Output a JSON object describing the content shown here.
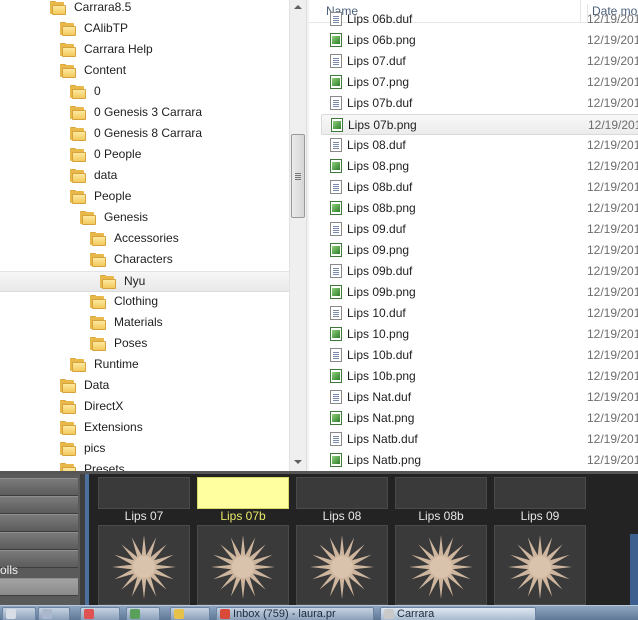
{
  "explorer": {
    "tree": [
      {
        "label": "Carrara8.5",
        "selected": false
      },
      {
        "label": "CAlibTP",
        "selected": false
      },
      {
        "label": "Carrara Help",
        "selected": false
      },
      {
        "label": "Content",
        "selected": false
      },
      {
        "label": "0",
        "selected": false
      },
      {
        "label": "0 Genesis 3 Carrara",
        "selected": false
      },
      {
        "label": "0 Genesis 8 Carrara",
        "selected": false
      },
      {
        "label": "0 People",
        "selected": false
      },
      {
        "label": "data",
        "selected": false
      },
      {
        "label": "People",
        "selected": false
      },
      {
        "label": "Genesis",
        "selected": false
      },
      {
        "label": "Accessories",
        "selected": false
      },
      {
        "label": "Characters",
        "selected": false
      },
      {
        "label": "Nyu",
        "selected": true
      },
      {
        "label": "Clothing",
        "selected": false
      },
      {
        "label": "Materials",
        "selected": false
      },
      {
        "label": "Poses",
        "selected": false
      },
      {
        "label": "Runtime",
        "selected": false
      },
      {
        "label": "Data",
        "selected": false
      },
      {
        "label": "DirectX",
        "selected": false
      },
      {
        "label": "Extensions",
        "selected": false
      },
      {
        "label": "pics",
        "selected": false
      },
      {
        "label": "Presets",
        "selected": false
      }
    ],
    "columns": {
      "name": "Name",
      "date": "Date mod"
    },
    "files": [
      {
        "name": "Lips 06b.duf",
        "date": "12/19/201",
        "kind": "doc",
        "selected": false
      },
      {
        "name": "Lips 06b.png",
        "date": "12/19/201",
        "kind": "img",
        "selected": false
      },
      {
        "name": "Lips 07.duf",
        "date": "12/19/201",
        "kind": "doc",
        "selected": false
      },
      {
        "name": "Lips 07.png",
        "date": "12/19/201",
        "kind": "img",
        "selected": false
      },
      {
        "name": "Lips 07b.duf",
        "date": "12/19/201",
        "kind": "doc",
        "selected": false
      },
      {
        "name": "Lips 07b.png",
        "date": "12/19/201",
        "kind": "img",
        "selected": true
      },
      {
        "name": "Lips 08.duf",
        "date": "12/19/201",
        "kind": "doc",
        "selected": false
      },
      {
        "name": "Lips 08.png",
        "date": "12/19/201",
        "kind": "img",
        "selected": false
      },
      {
        "name": "Lips 08b.duf",
        "date": "12/19/201",
        "kind": "doc",
        "selected": false
      },
      {
        "name": "Lips 08b.png",
        "date": "12/19/201",
        "kind": "img",
        "selected": false
      },
      {
        "name": "Lips 09.duf",
        "date": "12/19/201",
        "kind": "doc",
        "selected": false
      },
      {
        "name": "Lips 09.png",
        "date": "12/19/201",
        "kind": "img",
        "selected": false
      },
      {
        "name": "Lips 09b.duf",
        "date": "12/19/201",
        "kind": "doc",
        "selected": false
      },
      {
        "name": "Lips 09b.png",
        "date": "12/19/201",
        "kind": "img",
        "selected": false
      },
      {
        "name": "Lips 10.duf",
        "date": "12/19/201",
        "kind": "doc",
        "selected": false
      },
      {
        "name": "Lips 10.png",
        "date": "12/19/201",
        "kind": "img",
        "selected": false
      },
      {
        "name": "Lips 10b.duf",
        "date": "12/19/201",
        "kind": "doc",
        "selected": false
      },
      {
        "name": "Lips 10b.png",
        "date": "12/19/201",
        "kind": "img",
        "selected": false
      },
      {
        "name": "Lips Nat.duf",
        "date": "12/19/201",
        "kind": "doc",
        "selected": false
      },
      {
        "name": "Lips Nat.png",
        "date": "12/19/201",
        "kind": "img",
        "selected": false
      },
      {
        "name": "Lips Natb.duf",
        "date": "12/19/201",
        "kind": "doc",
        "selected": false
      },
      {
        "name": "Lips Natb.png",
        "date": "12/19/201",
        "kind": "img",
        "selected": false
      }
    ]
  },
  "carrara": {
    "side_tab_label": "olls",
    "thumbnails": [
      {
        "label": "Lips 07",
        "selected": false
      },
      {
        "label": "Lips 07b",
        "selected": true
      },
      {
        "label": "Lips 08",
        "selected": false
      },
      {
        "label": "Lips 08b",
        "selected": false
      },
      {
        "label": "Lips 09",
        "selected": false
      }
    ],
    "colors": {
      "selected_label": "#e9e96a",
      "selected_thumb": "#ffffa0",
      "scroll_accent": "#4d6f9b"
    }
  },
  "taskbar": {
    "items": [
      {
        "text": "",
        "icon": "app-icon"
      },
      {
        "text": "",
        "icon": "app-icon"
      },
      {
        "text": "",
        "icon": "app-icon"
      },
      {
        "text": "",
        "icon": "app-icon"
      },
      {
        "text": "",
        "icon": "app-icon"
      },
      {
        "text": "Inbox (759) - laura.pr",
        "icon": "chrome-icon"
      },
      {
        "text": "Carrara",
        "icon": "carrara-icon"
      }
    ]
  }
}
